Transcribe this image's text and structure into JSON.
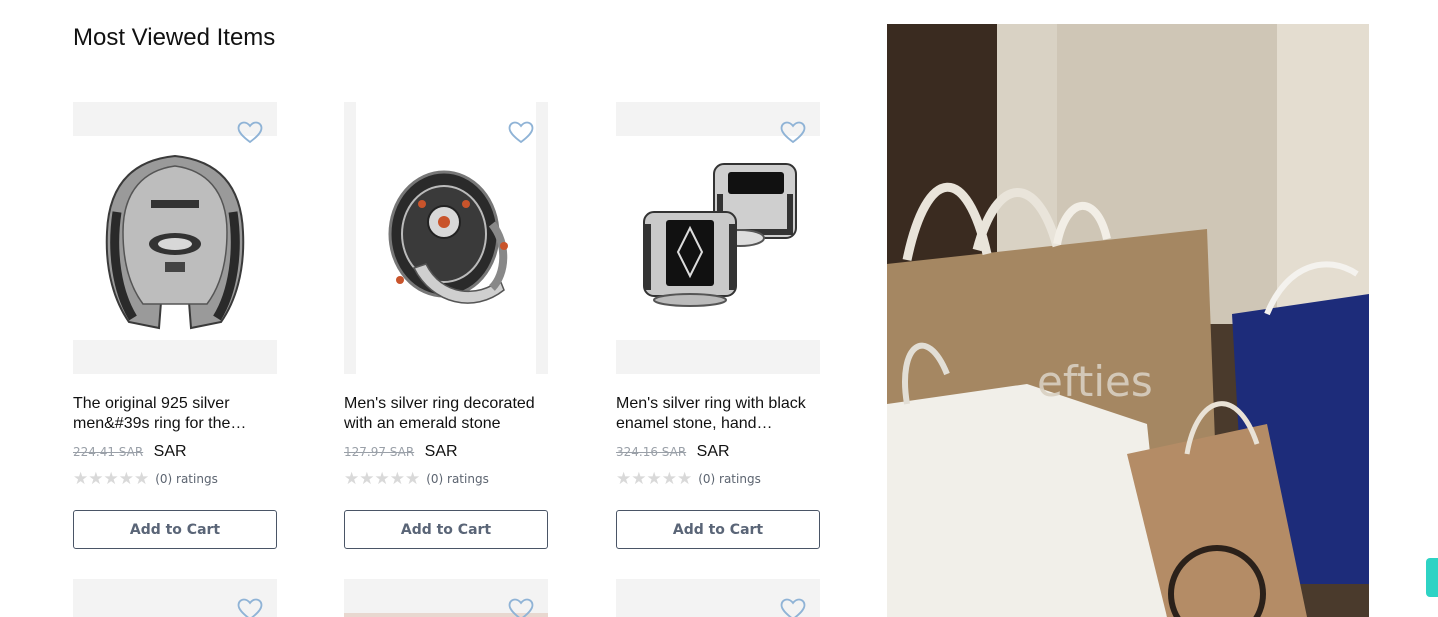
{
  "section": {
    "title": "Most Viewed Items"
  },
  "products": [
    {
      "title": "The original 925 silver men&#39s ring for the…",
      "old_price": "224.41 SAR",
      "currency": "SAR",
      "stars": "★★★★★",
      "ratings": "(0) ratings",
      "add_label": "Add to Cart",
      "rating_value": 0
    },
    {
      "title": "Men's silver ring decorated with an emerald stone",
      "old_price": "127.97 SAR",
      "currency": "SAR",
      "stars": "★★★★★",
      "ratings": "(0) ratings",
      "add_label": "Add to Cart",
      "rating_value": 0
    },
    {
      "title": "Men's silver ring with black enamel stone, hand…",
      "old_price": "324.16 SAR",
      "currency": "SAR",
      "stars": "★★★★★",
      "ratings": "(0) ratings",
      "add_label": "Add to Cart",
      "rating_value": 0
    }
  ],
  "colors": {
    "heart": "#8fb3d6",
    "button_border": "#4a5566",
    "chat_tab": "#2ed3c4"
  },
  "icons": {
    "wishlist": "heart-outline-icon"
  }
}
